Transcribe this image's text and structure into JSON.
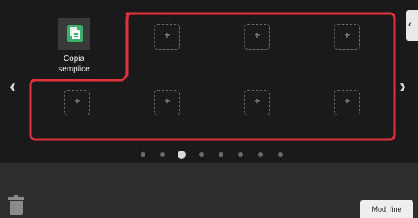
{
  "app": {
    "label": "Copia semplice",
    "icon": "copy-document-icon",
    "icon_color": "#3fae6a"
  },
  "slots": {
    "symbol": "+",
    "icon": "add-slot-icon"
  },
  "nav": {
    "prev_label": "‹",
    "next_label": "›",
    "side_tab_label": "‹"
  },
  "pagination": {
    "total_pages": 8,
    "current_page": 3
  },
  "footer": {
    "finish_label": "Mod. fine",
    "trash_icon": "trash-icon"
  },
  "colors": {
    "panel": "#1a1a1a",
    "footer": "#2e2e2e",
    "highlight": "#e0333f"
  }
}
